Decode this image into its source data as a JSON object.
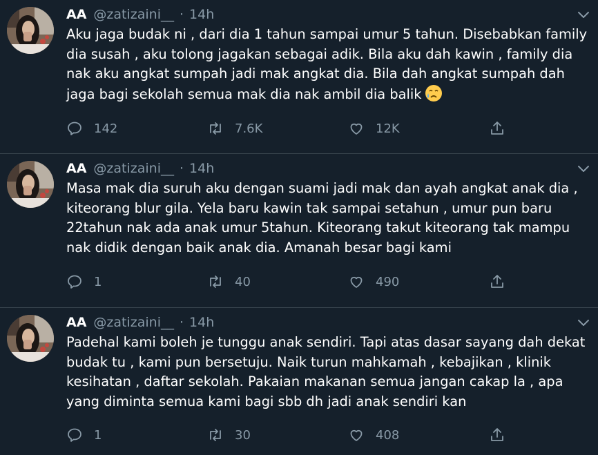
{
  "tweets": [
    {
      "name": "AA",
      "handle": "@zatizaini__",
      "separator": "·",
      "time": "14h",
      "text": "Aku jaga budak ni , dari dia 1 tahun sampai umur 5 tahun. Disebabkan family dia susah , aku tolong jagakan sebagai adik. Bila aku dah kawin , family dia nak aku angkat sumpah jadi mak angkat dia. Bila dah angkat sumpah dah jaga bagi sekolah semua mak dia nak ambil dia balik",
      "emoji": "crying-face-emoji",
      "replies": "142",
      "retweets": "7.6K",
      "likes": "12K"
    },
    {
      "name": "AA",
      "handle": "@zatizaini__",
      "separator": "·",
      "time": "14h",
      "text": "Masa mak dia suruh aku dengan suami jadi mak dan ayah angkat anak dia , kiteorang blur gila. Yela baru kawin tak sampai setahun , umur pun baru 22tahun nak ada anak umur 5tahun. Kiteorang takut kiteorang tak mampu nak didik dengan baik anak dia. Amanah besar bagi kami",
      "replies": "1",
      "retweets": "40",
      "likes": "490"
    },
    {
      "name": "AA",
      "handle": "@zatizaini__",
      "separator": "·",
      "time": "14h",
      "text": "Padehal kami boleh je tunggu anak sendiri. Tapi atas dasar sayang dah dekat budak tu , kami pun bersetuju. Naik turun mahkamah , kebajikan , klinik kesihatan , daftar sekolah. Pakaian makanan semua jangan cakap la , apa yang diminta semua kami bagi sbb dh jadi anak sendiri kan",
      "replies": "1",
      "retweets": "30",
      "likes": "408"
    }
  ],
  "colors": {
    "background": "#15202b",
    "text": "#ffffff",
    "secondary": "#8899a6",
    "divider": "#38444d"
  },
  "icons": [
    "chevron-down-icon",
    "reply-icon",
    "retweet-icon",
    "like-icon",
    "share-icon"
  ]
}
